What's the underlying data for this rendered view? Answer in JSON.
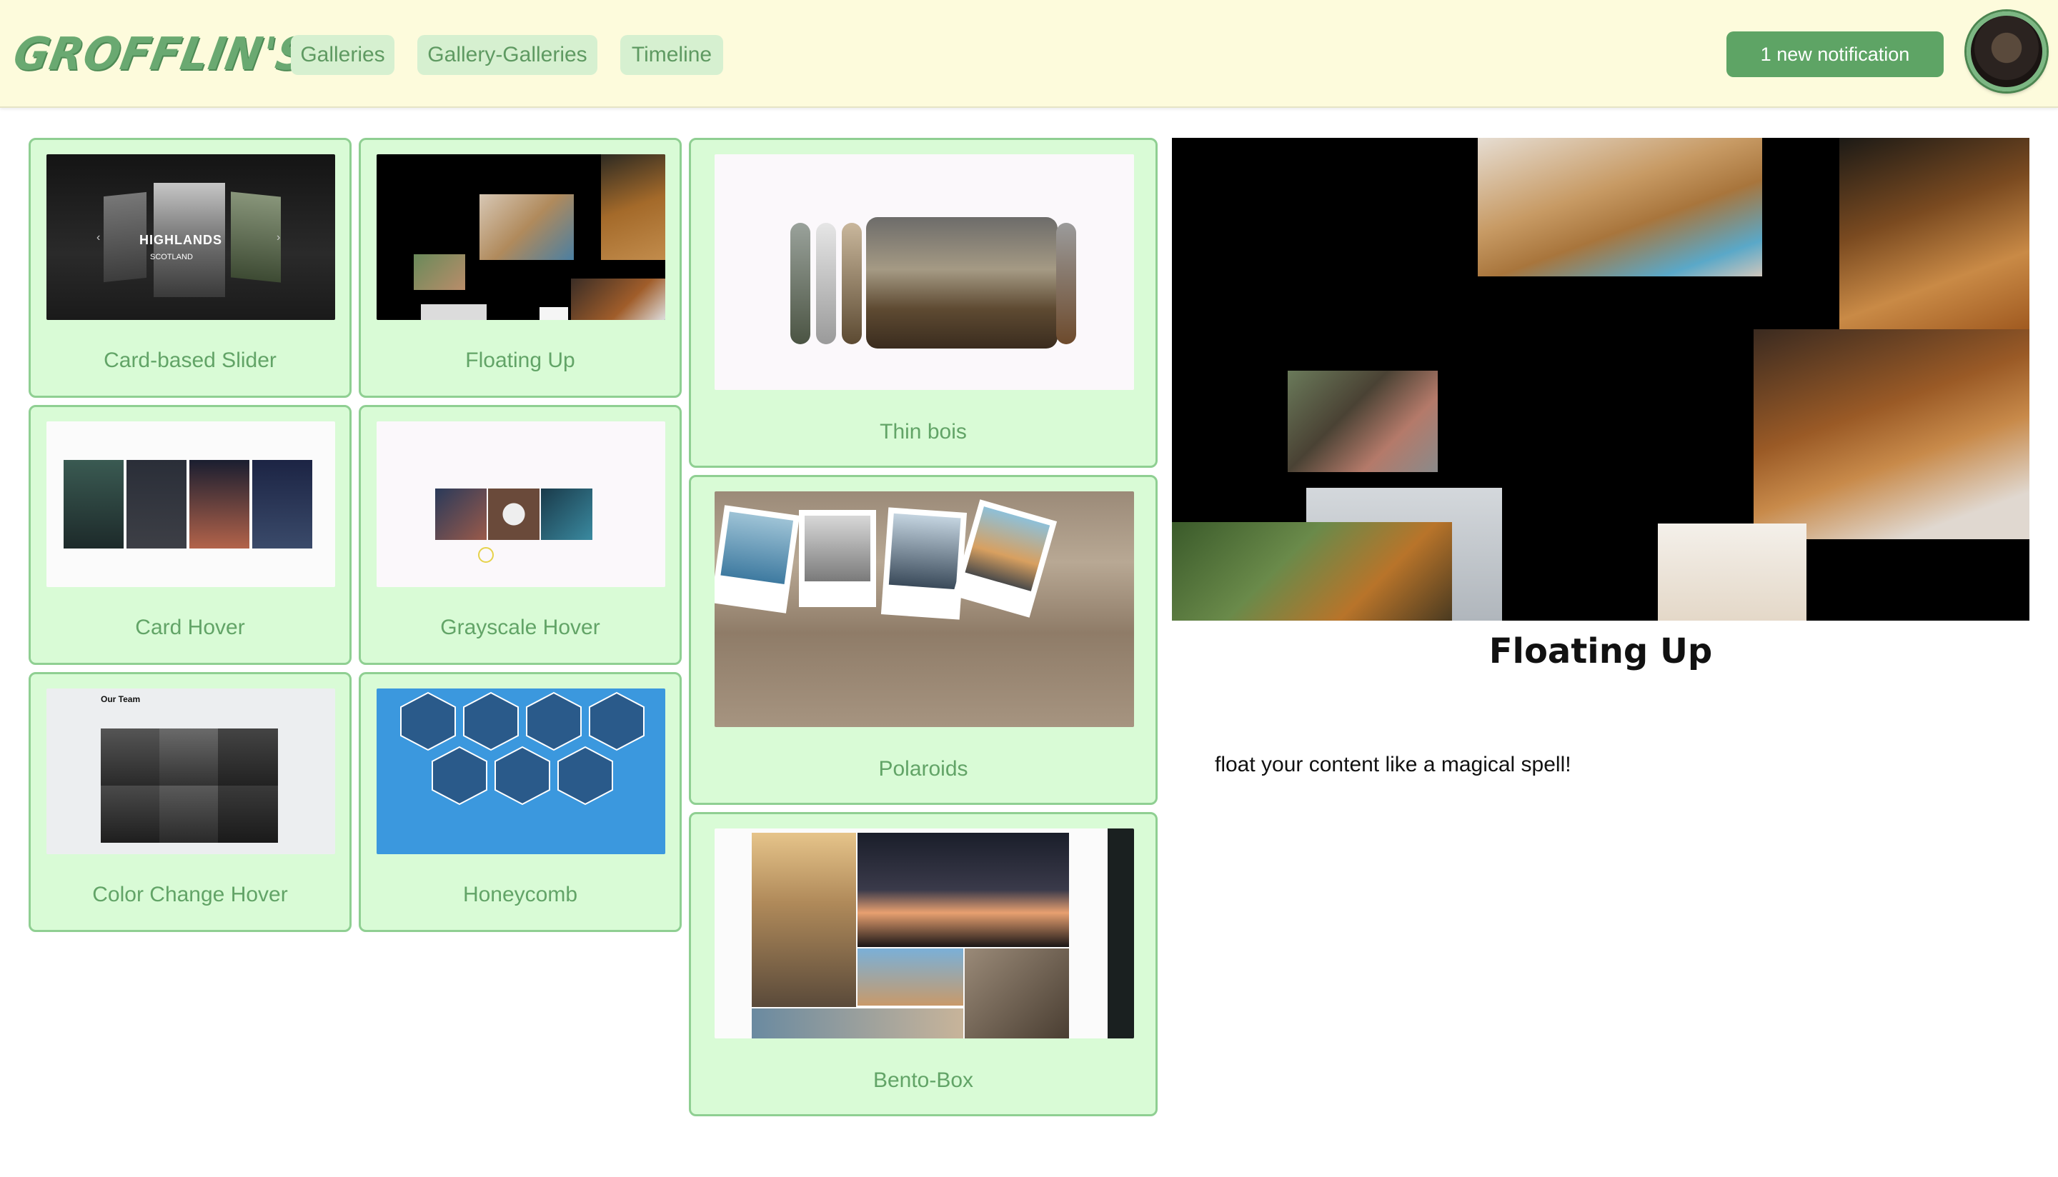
{
  "header": {
    "logo_text": "GROFFLIN'S",
    "nav": [
      {
        "label": "Galleries"
      },
      {
        "label": "Gallery-Galleries"
      },
      {
        "label": "Timeline"
      }
    ],
    "notification_label": "1 new notification"
  },
  "cards": [
    {
      "label": "Card-based Slider",
      "thumb_text": "HIGHLANDS",
      "thumb_sub": "SCOTLAND"
    },
    {
      "label": "Floating Up"
    },
    {
      "label": "Thin bois"
    },
    {
      "label": "Card Hover"
    },
    {
      "label": "Grayscale Hover"
    },
    {
      "label": "Polaroids"
    },
    {
      "label": "Color Change Hover",
      "thumb_text": "Our Team"
    },
    {
      "label": "Honeycomb"
    },
    {
      "label": "Bento-Box"
    }
  ],
  "preview": {
    "title": "Floating Up",
    "description": "float your content like a magical spell!"
  },
  "colors": {
    "header_bg": "#fdfbdc",
    "card_bg": "#d9fbd6",
    "card_border": "#8fcf92",
    "accent": "#5ea465",
    "label_text": "#62a467"
  }
}
